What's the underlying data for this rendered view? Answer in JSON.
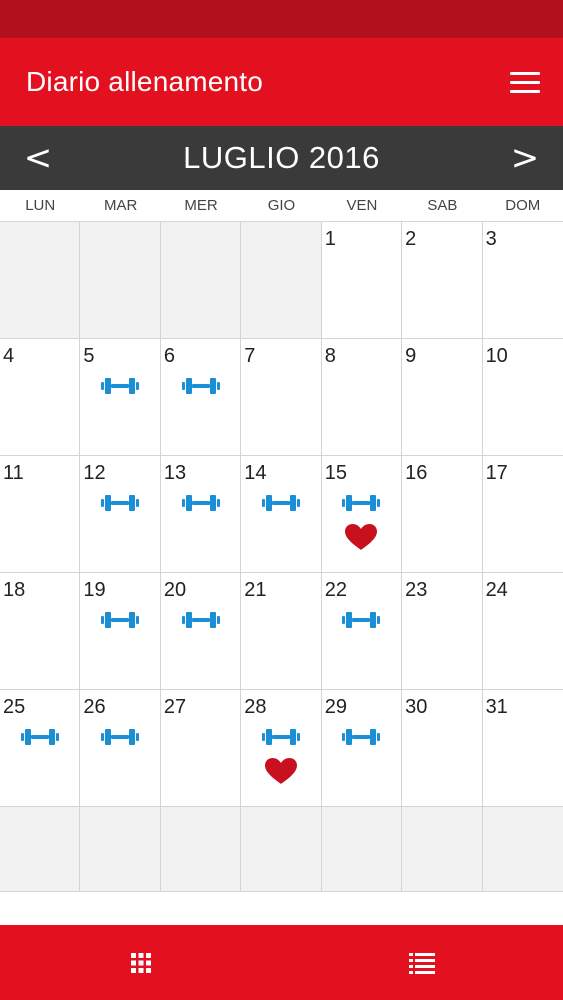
{
  "app": {
    "title": "Diario allenamento"
  },
  "calendar": {
    "month_label": "LUGLIO 2016",
    "prev_label": "<",
    "next_label": ">",
    "weekdays": [
      "LUN",
      "MAR",
      "MER",
      "GIO",
      "VEN",
      "SAB",
      "DOM"
    ],
    "leading_blank_days": 4,
    "days_in_month": 31,
    "trailing_blank_days": 7,
    "workout_days": [
      5,
      6,
      12,
      13,
      14,
      15,
      19,
      20,
      22,
      25,
      26,
      28,
      29
    ],
    "cardio_days": [
      15,
      28
    ],
    "icons": {
      "workout": "dumbbell-icon",
      "cardio": "heart-icon"
    },
    "colors": {
      "workout": "#1a8fd8",
      "cardio": "#c8101e"
    }
  },
  "tabs": [
    {
      "name": "calendar-grid-view",
      "icon": "grid-icon",
      "selected": true
    },
    {
      "name": "list-view",
      "icon": "list-icon",
      "selected": false
    }
  ],
  "colors": {
    "primary": "#e31020",
    "status_bar": "#b2101d",
    "month_bar": "#3a3a3a",
    "tab_indicator": "#f08b92"
  }
}
